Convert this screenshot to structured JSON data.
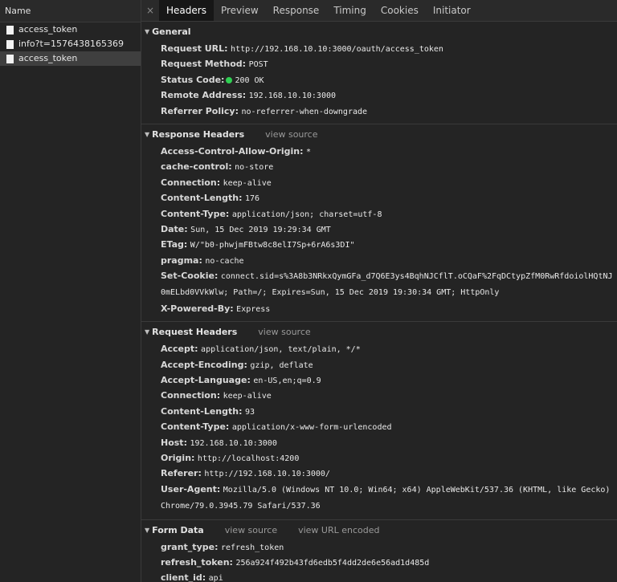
{
  "left": {
    "header": "Name",
    "requests": [
      {
        "name": "access_token"
      },
      {
        "name": "info?t=1576438165369"
      },
      {
        "name": "access_token"
      }
    ]
  },
  "tabs": {
    "close": "×",
    "items": [
      "Headers",
      "Preview",
      "Response",
      "Timing",
      "Cookies",
      "Initiator"
    ]
  },
  "general": {
    "title": "General",
    "rows": [
      {
        "k": "Request URL:",
        "v": "http://192.168.10.10:3000/oauth/access_token"
      },
      {
        "k": "Request Method:",
        "v": "POST"
      },
      {
        "k": "Status Code:",
        "v": "200 OK"
      },
      {
        "k": "Remote Address:",
        "v": "192.168.10.10:3000"
      },
      {
        "k": "Referrer Policy:",
        "v": "no-referrer-when-downgrade"
      }
    ]
  },
  "response_headers": {
    "title": "Response Headers",
    "view_source": "view source",
    "rows": [
      {
        "k": "Access-Control-Allow-Origin:",
        "v": "*"
      },
      {
        "k": "cache-control:",
        "v": "no-store"
      },
      {
        "k": "Connection:",
        "v": "keep-alive"
      },
      {
        "k": "Content-Length:",
        "v": "176"
      },
      {
        "k": "Content-Type:",
        "v": "application/json; charset=utf-8"
      },
      {
        "k": "Date:",
        "v": "Sun, 15 Dec 2019 19:29:34 GMT"
      },
      {
        "k": "ETag:",
        "v": "W/\"b0-phwjmFBtw8c8elI7Sp+6rA6s3DI\""
      },
      {
        "k": "pragma:",
        "v": "no-cache"
      },
      {
        "k": "Set-Cookie:",
        "v": "connect.sid=s%3A8b3NRkxQymGFa_d7Q6E3ys4BqhNJCflT.oCQaF%2FqDCtypZfM0RwRfdoiolHQtNJ0mELbd0VVkWlw; Path=/; Expires=Sun, 15 Dec 2019 19:30:34 GMT; HttpOnly"
      },
      {
        "k": "X-Powered-By:",
        "v": "Express"
      }
    ]
  },
  "request_headers": {
    "title": "Request Headers",
    "view_source": "view source",
    "rows": [
      {
        "k": "Accept:",
        "v": "application/json, text/plain, */*"
      },
      {
        "k": "Accept-Encoding:",
        "v": "gzip, deflate"
      },
      {
        "k": "Accept-Language:",
        "v": "en-US,en;q=0.9"
      },
      {
        "k": "Connection:",
        "v": "keep-alive"
      },
      {
        "k": "Content-Length:",
        "v": "93"
      },
      {
        "k": "Content-Type:",
        "v": "application/x-www-form-urlencoded"
      },
      {
        "k": "Host:",
        "v": "192.168.10.10:3000"
      },
      {
        "k": "Origin:",
        "v": "http://localhost:4200"
      },
      {
        "k": "Referer:",
        "v": "http://192.168.10.10:3000/"
      },
      {
        "k": "User-Agent:",
        "v": "Mozilla/5.0 (Windows NT 10.0; Win64; x64) AppleWebKit/537.36 (KHTML, like Gecko) Chrome/79.0.3945.79 Safari/537.36"
      }
    ]
  },
  "form_data": {
    "title": "Form Data",
    "view_source": "view source",
    "view_url_encoded": "view URL encoded",
    "rows": [
      {
        "k": "grant_type:",
        "v": "refresh_token"
      },
      {
        "k": "refresh_token:",
        "v": "256a924f492b43fd6edb5f4dd2de6e56ad1d485d"
      },
      {
        "k": "client_id:",
        "v": "api"
      }
    ]
  },
  "colors": {
    "status_ok": "#2fcf52",
    "tab_active_bg": "#171717"
  }
}
